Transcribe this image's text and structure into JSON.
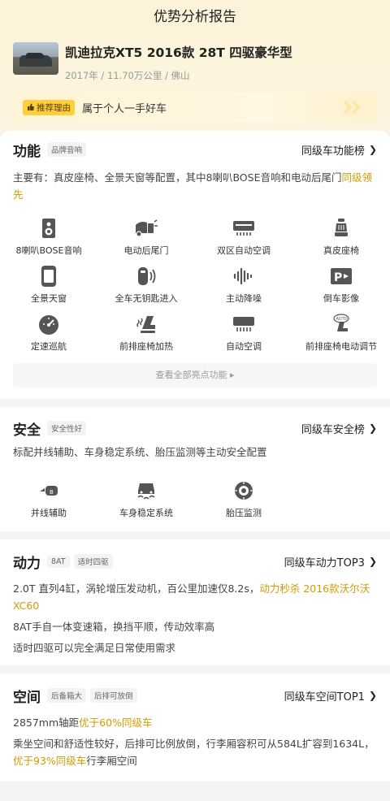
{
  "page": {
    "title": "优势分析报告"
  },
  "car": {
    "name": "凯迪拉克XT5 2016款 28T 四驱豪华型",
    "meta": "2017年 / 11.70万公里 / 佛山"
  },
  "reason": {
    "tag": "推荐理由",
    "text": "属于个人一手好车"
  },
  "function": {
    "title": "功能",
    "chip": "品牌音响",
    "rank": "同级车功能榜",
    "desc_prefix": "主要有：真皮座椅、全景天窗等配置，其中8喇叭BOSE音响和电动后尾门",
    "desc_highlight": "同级领先",
    "features": [
      {
        "label": "8喇叭BOSE音响",
        "icon": "speaker-icon"
      },
      {
        "label": "电动后尾门",
        "icon": "power-tailgate-icon"
      },
      {
        "label": "双区自动空调",
        "icon": "dual-zone-ac-icon"
      },
      {
        "label": "真皮座椅",
        "icon": "leather-seat-icon"
      },
      {
        "label": "全景天窗",
        "icon": "panoramic-sunroof-icon"
      },
      {
        "label": "全车无钥匙进入",
        "icon": "keyless-entry-icon"
      },
      {
        "label": "主动降噪",
        "icon": "noise-cancel-icon"
      },
      {
        "label": "倒车影像",
        "icon": "reverse-camera-icon"
      },
      {
        "label": "定速巡航",
        "icon": "cruise-control-icon"
      },
      {
        "label": "前排座椅加热",
        "icon": "seat-heating-icon"
      },
      {
        "label": "自动空调",
        "icon": "auto-ac-icon"
      },
      {
        "label": "前排座椅电动调节",
        "icon": "power-seat-icon"
      }
    ],
    "more": "查看全部亮点功能 ▸"
  },
  "safety": {
    "title": "安全",
    "chip": "安全性好",
    "rank": "同级车安全榜",
    "desc": "标配并线辅助、车身稳定系统、胎压监测等主动安全配置",
    "features": [
      {
        "label": "并线辅助",
        "icon": "lane-assist-icon"
      },
      {
        "label": "车身稳定系统",
        "icon": "stability-icon"
      },
      {
        "label": "胎压监测",
        "icon": "tire-pressure-icon"
      }
    ]
  },
  "power": {
    "title": "动力",
    "chips": [
      "8AT",
      "适时四驱"
    ],
    "rank": "同级车动力TOP3",
    "line1_prefix": "2.0T 直列4缸，涡轮增压发动机，百公里加速仅8.2s，",
    "line1_highlight": "动力秒杀 2016款沃尔沃XC60",
    "line2": "8AT手自一体变速箱，换挡平顺，传动效率高",
    "line3": "适时四驱可以完全满足日常使用需求"
  },
  "space": {
    "title": "空间",
    "chips": [
      "后备箱大",
      "后排可放倒"
    ],
    "rank": "同级车空间TOP1",
    "line1_prefix": "2857mm轴距",
    "line1_highlight": "优于60%同级车",
    "line2_prefix": "乘坐空间和舒适性较好，后排可比例放倒，行李厢容积可从584L扩容到1634L，",
    "line2_highlight": "优于93%同级车",
    "line2_suffix": "行李厢空间"
  },
  "colors": {
    "accent": "#d39a00",
    "tag_bg": "#ffce3d"
  }
}
